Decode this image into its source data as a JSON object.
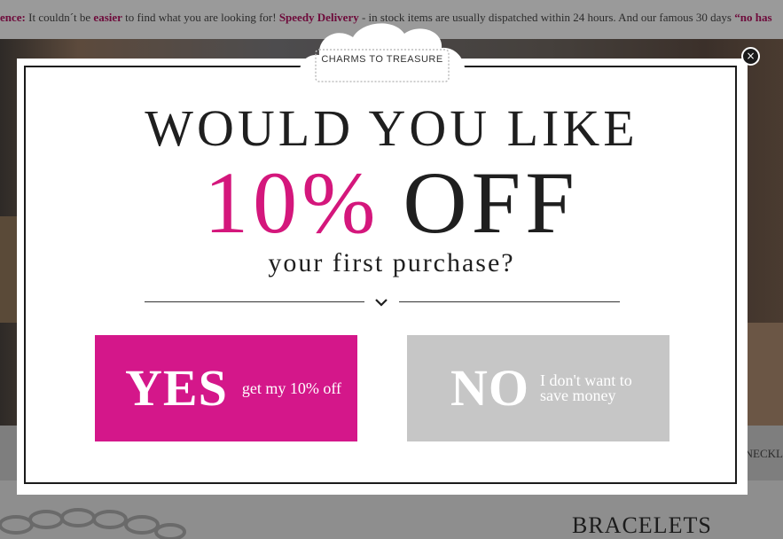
{
  "background": {
    "announcement_prefix": "ence:",
    "announcement_text_1": " It couldn´t be ",
    "announcement_emph_1": "easier",
    "announcement_text_2": " to find what you are looking for! ",
    "announcement_emph_2": "Speedy Delivery",
    "announcement_text_3": " - in stock items are usually dispatched within 24 hours. And our famous 30 days ",
    "announcement_emph_3": "“no has",
    "nav_partial": "NECKL",
    "section_heading": "BRACELETS"
  },
  "popup": {
    "logo_text": "CHARMS TO TREASURE",
    "close_glyph": "×",
    "headline": "WOULD YOU LIKE",
    "offer_percent": "10%",
    "offer_word": "OFF",
    "subline": "your first purchase?",
    "yes_button": {
      "main": "YES",
      "sub": "get my 10% off"
    },
    "no_button": {
      "main": "NO",
      "sub": "I don't want to save money"
    }
  },
  "colors": {
    "accent_pink": "#d4178a",
    "no_button_gray": "#c6c6c6",
    "text_dark": "#1f1f1f"
  }
}
